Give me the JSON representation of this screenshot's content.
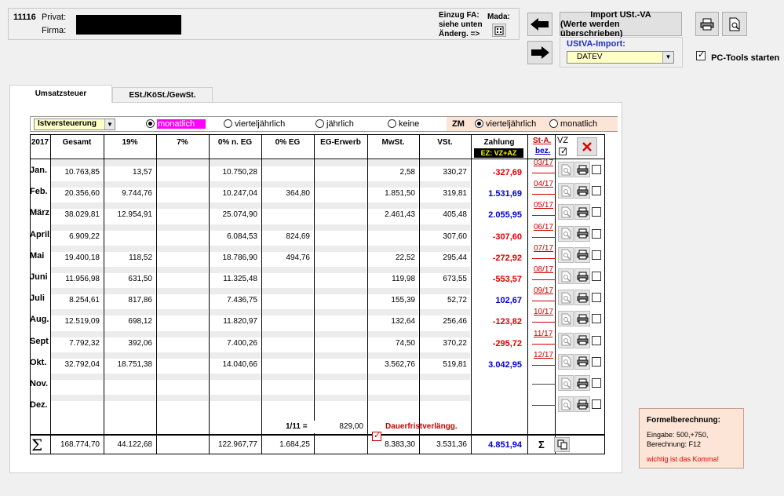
{
  "header": {
    "client_no": "11116",
    "privat_label": "Privat:",
    "firma_label": "Firma:",
    "einzug_line1": "Einzug FA:",
    "einzug_line2": "siehe unten",
    "einzug_line3": "Änderg. =>",
    "mada_label": "Mada:",
    "import_line1": "Import USt.-VA",
    "import_line2": "(Werte werden überschrieben)",
    "ustva_import_label": "UStVA-Import:",
    "ustva_import_value": "DATEV",
    "pctools_label": "PC-Tools starten",
    "pctools_checked": true
  },
  "tabs": [
    {
      "label": "Umsatzsteuer",
      "active": true
    },
    {
      "label": "ESt./KöSt./GewSt.",
      "active": false
    }
  ],
  "options": {
    "mode_value": "Istversteuerung",
    "period_options": [
      "monatlich",
      "vierteljährlich",
      "jährlich",
      "keine"
    ],
    "period_selected": "monatlich",
    "zm_label": "ZM",
    "zm_options": [
      "vierteljährlich",
      "monatlich"
    ],
    "zm_selected": "vierteljährlich"
  },
  "table": {
    "year": "2017",
    "columns": [
      "Gesamt",
      "19%",
      "7%",
      "0% n. EG",
      "0% EG",
      "EG-Erwerb",
      "MwSt.",
      "VSt."
    ],
    "zahlung_label": "Zahlung",
    "ez_label": "EZ: VZ+AZ",
    "sta_label": "St-A.",
    "bez_label": "bez.",
    "vz_label": "VZ",
    "rows": [
      {
        "month": "Jan.",
        "values": [
          "10.763,85",
          "13,57",
          "",
          "10.750,28",
          "",
          "",
          "2,58",
          "330,27"
        ],
        "zahlung": "-327,69",
        "neg": true,
        "st": "03/17"
      },
      {
        "month": "Feb.",
        "values": [
          "20.356,60",
          "9.744,76",
          "",
          "10.247,04",
          "364,80",
          "",
          "1.851,50",
          "319,81"
        ],
        "zahlung": "1.531,69",
        "neg": false,
        "st": "04/17"
      },
      {
        "month": "März",
        "values": [
          "38.029,81",
          "12.954,91",
          "",
          "25.074,90",
          "",
          "",
          "2.461,43",
          "405,48"
        ],
        "zahlung": "2.055,95",
        "neg": false,
        "st": "05/17"
      },
      {
        "month": "April",
        "values": [
          "6.909,22",
          "",
          "",
          "6.084,53",
          "824,69",
          "",
          "",
          "307,60"
        ],
        "zahlung": "-307,60",
        "neg": true,
        "st": "06/17"
      },
      {
        "month": "Mai",
        "values": [
          "19.400,18",
          "118,52",
          "",
          "18.786,90",
          "494,76",
          "",
          "22,52",
          "295,44"
        ],
        "zahlung": "-272,92",
        "neg": true,
        "st": "07/17"
      },
      {
        "month": "Juni",
        "values": [
          "11.956,98",
          "631,50",
          "",
          "11.325,48",
          "",
          "",
          "119,98",
          "673,55"
        ],
        "zahlung": "-553,57",
        "neg": true,
        "st": "08/17"
      },
      {
        "month": "Juli",
        "values": [
          "8.254,61",
          "817,86",
          "",
          "7.436,75",
          "",
          "",
          "155,39",
          "52,72"
        ],
        "zahlung": "102,67",
        "neg": false,
        "st": "09/17"
      },
      {
        "month": "Aug.",
        "values": [
          "12.519,09",
          "698,12",
          "",
          "11.820,97",
          "",
          "",
          "132,64",
          "256,46"
        ],
        "zahlung": "-123,82",
        "neg": true,
        "st": "10/17"
      },
      {
        "month": "Sept",
        "values": [
          "7.792,32",
          "392,06",
          "",
          "7.400,26",
          "",
          "",
          "74,50",
          "370,22"
        ],
        "zahlung": "-295,72",
        "neg": true,
        "st": "11/17"
      },
      {
        "month": "Okt.",
        "values": [
          "32.792,04",
          "18.751,38",
          "",
          "14.040,66",
          "",
          "",
          "3.562,76",
          "519,81"
        ],
        "zahlung": "3.042,95",
        "neg": false,
        "st": "12/17"
      },
      {
        "month": "Nov.",
        "values": [
          "",
          "",
          "",
          "",
          "",
          "",
          "",
          ""
        ],
        "zahlung": "",
        "neg": false,
        "st": ""
      },
      {
        "month": "Dez.",
        "values": [
          "",
          "",
          "",
          "",
          "",
          "",
          "",
          ""
        ],
        "zahlung": "",
        "neg": false,
        "st": ""
      }
    ],
    "sondervz_label": "1/11 =",
    "sondervz_value": "829,00",
    "dauerfrist_label": "Dauerfristverlängg.",
    "sigma": "Σ",
    "totals": [
      "168.774,70",
      "44.122,68",
      "",
      "122.967,77",
      "1.684,25",
      "",
      "8.383,30",
      "3.531,36"
    ],
    "total_zahlung": "4.851,94"
  },
  "formula": {
    "title": "Formelberechnung:",
    "line1": "Eingabe: 500,+750,",
    "line2": "Berechnung: F12",
    "warning": "wichtig ist das Komma!"
  },
  "colors": {
    "negative": "#e00000",
    "positive": "#0000c8",
    "magenta": "#ff00ff",
    "zm_bg": "#fce4d6",
    "formula_bg": "#fce4d6",
    "ez_bg": "#000000",
    "ez_fg": "#ffff00"
  }
}
